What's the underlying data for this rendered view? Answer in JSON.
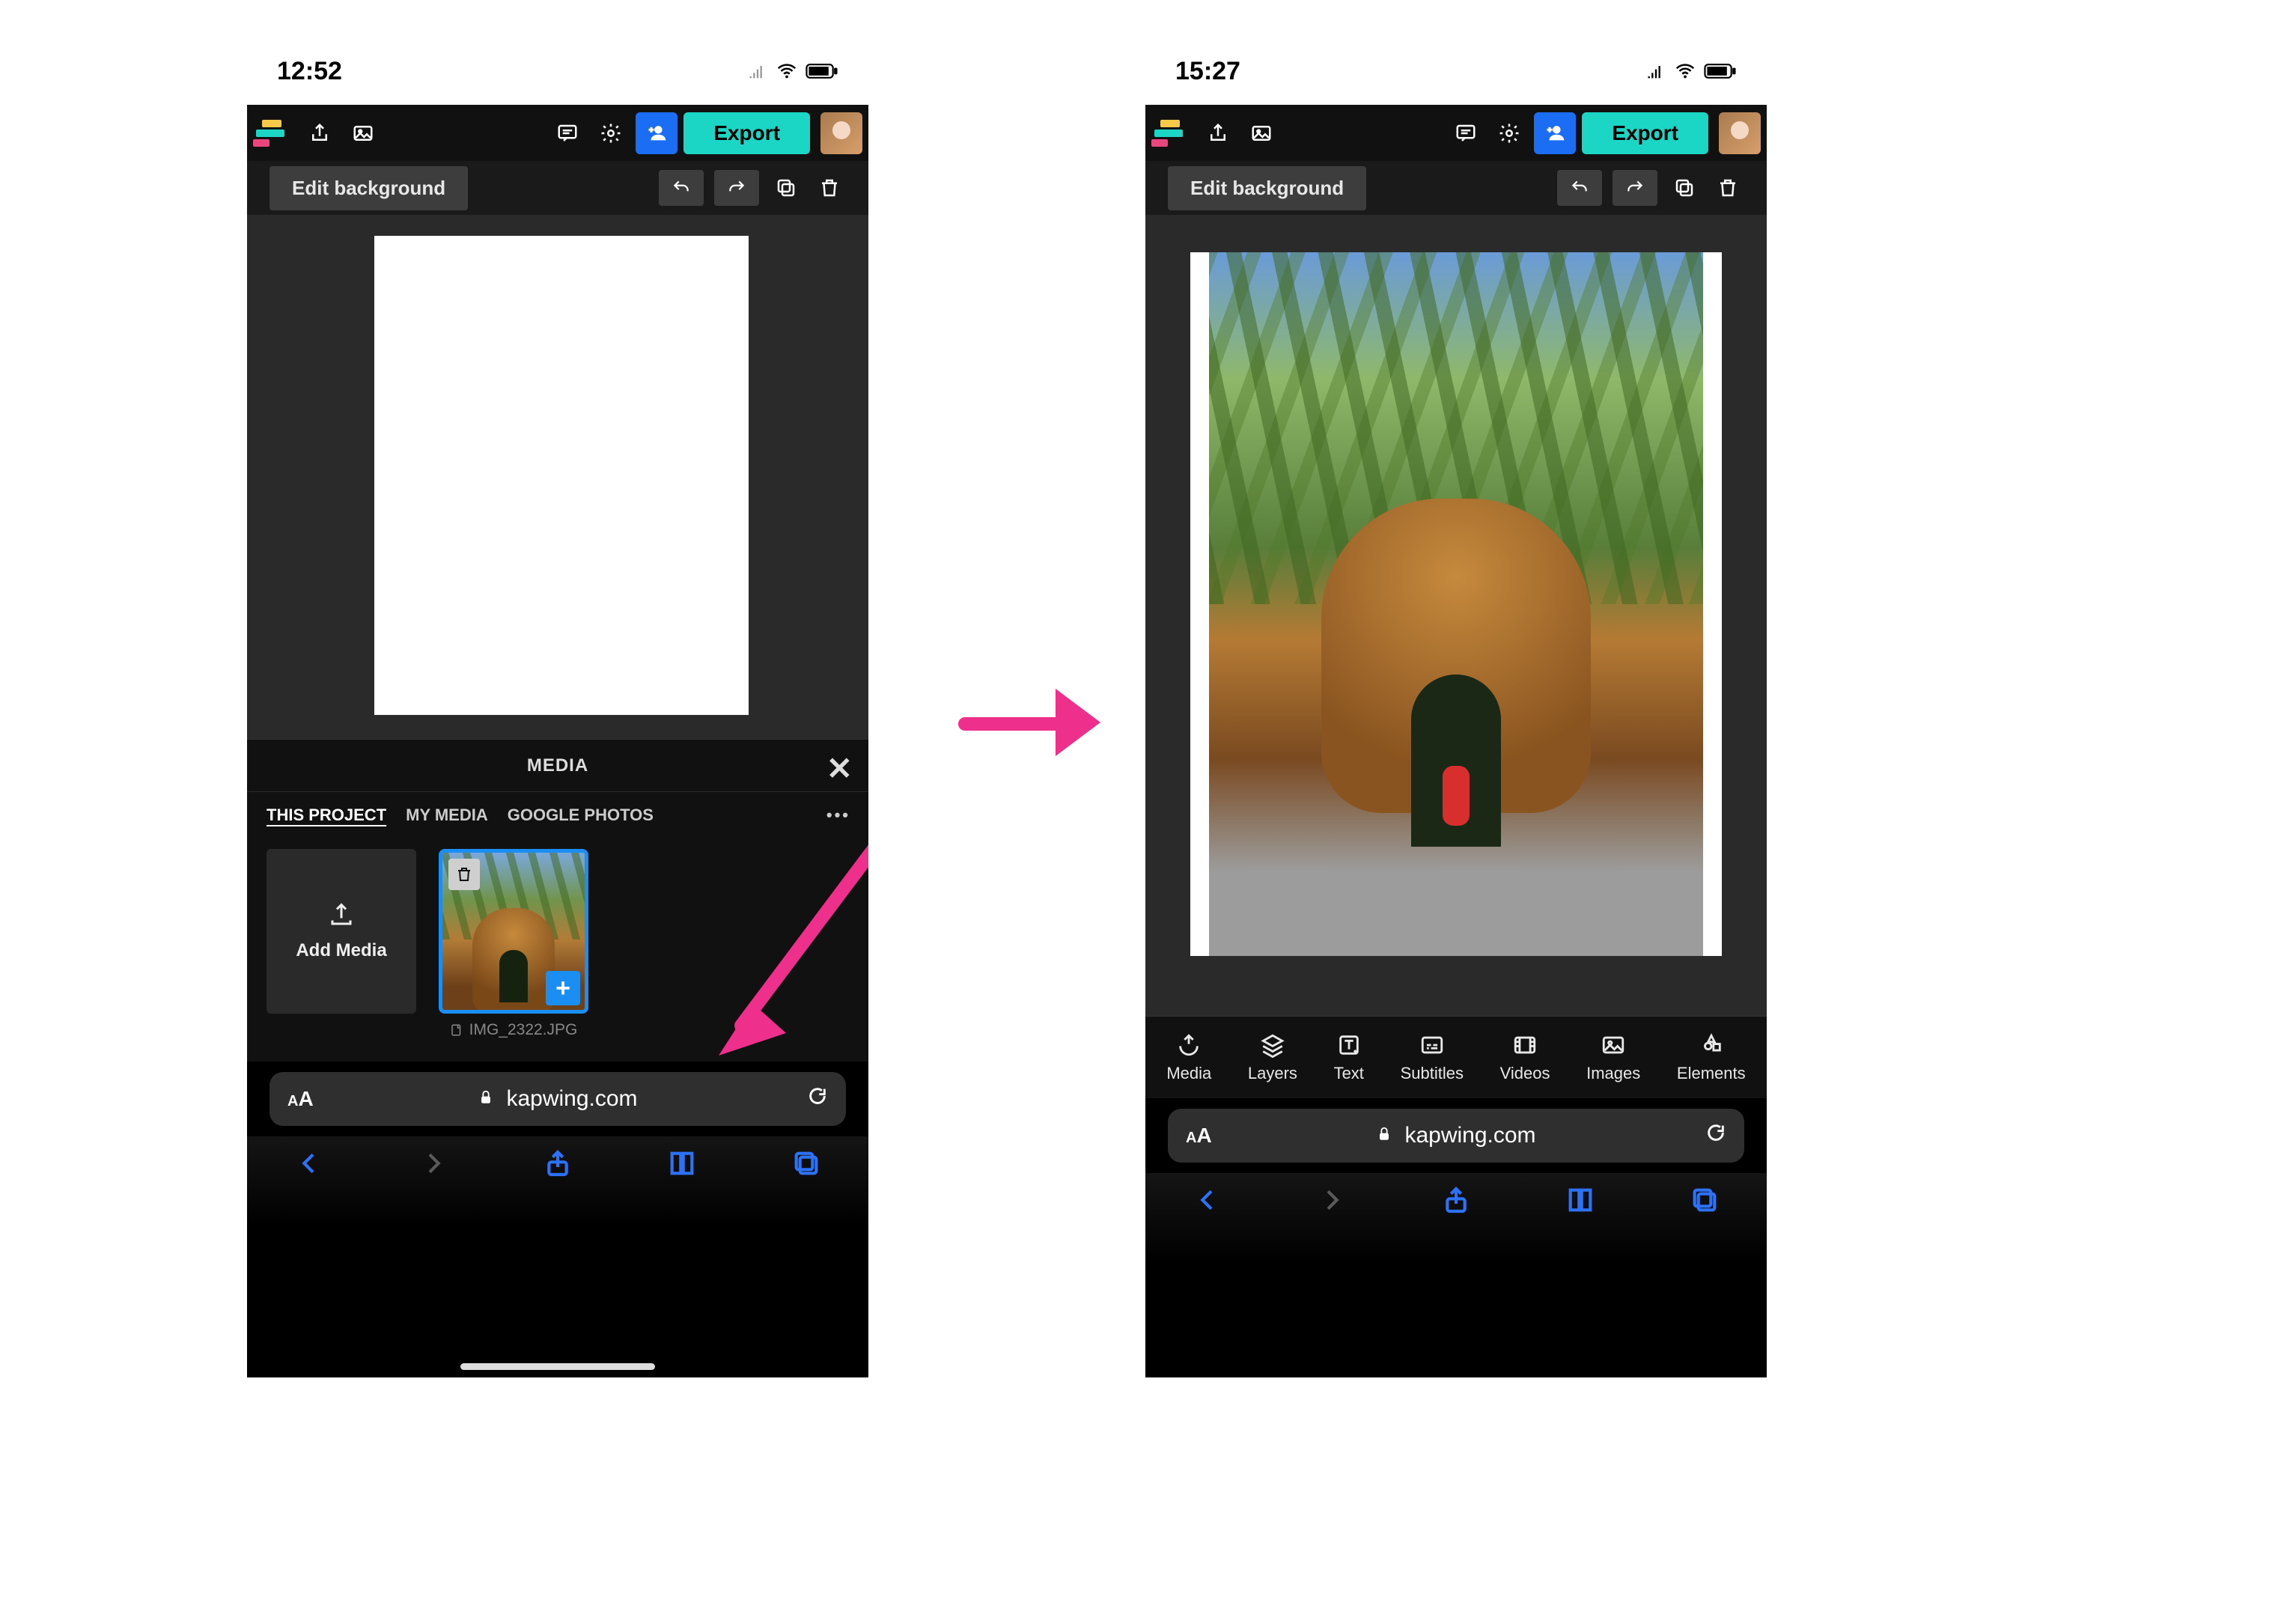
{
  "left": {
    "status": {
      "time": "12:52"
    },
    "toolbar": {
      "export_label": "Export",
      "edit_bg_label": "Edit background"
    },
    "media": {
      "title": "MEDIA",
      "tabs": [
        "THIS PROJECT",
        "MY MEDIA",
        "GOOGLE PHOTOS"
      ],
      "add_label": "Add Media",
      "thumb_filename": "IMG_2322.JPG"
    },
    "safari": {
      "url": "kapwing.com"
    }
  },
  "right": {
    "status": {
      "time": "15:27"
    },
    "toolbar": {
      "export_label": "Export",
      "edit_bg_label": "Edit background"
    },
    "editor_tabs": [
      "Media",
      "Layers",
      "Text",
      "Subtitles",
      "Videos",
      "Images",
      "Elements"
    ],
    "safari": {
      "url": "kapwing.com"
    }
  },
  "colors": {
    "accent_teal": "#1bd6c4",
    "accent_blue": "#1b8ef3",
    "accent_pink": "#ef2f8c"
  }
}
